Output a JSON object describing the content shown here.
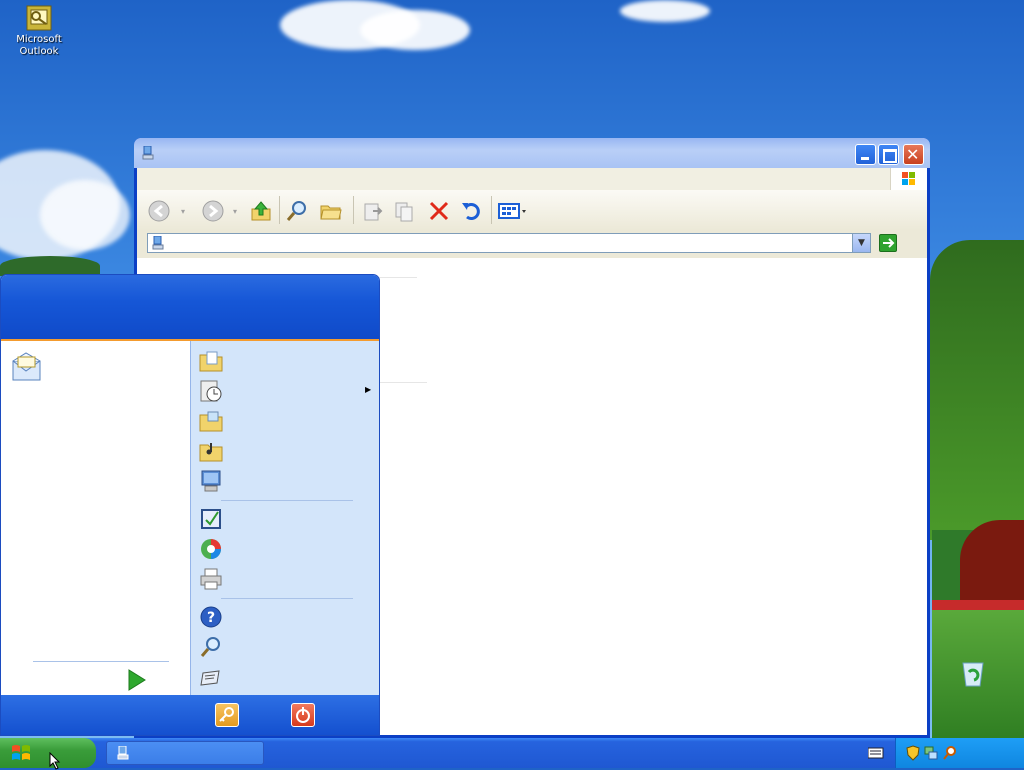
{
  "desktop": {
    "icons": [
      {
        "label_line1": "Microsoft",
        "label_line2": "Outlook",
        "icon": "outlook-icon"
      },
      {
        "label_line1": "",
        "label_line2": "",
        "icon": "recycle-bin-icon"
      }
    ]
  },
  "window": {
    "title": "",
    "address_value": "",
    "toolbar_icons": [
      "back-icon",
      "forward-icon",
      "up-folder-icon",
      "search-icon",
      "folders-icon",
      "move-to-icon",
      "copy-to-icon",
      "delete-icon",
      "undo-icon",
      "views-icon"
    ]
  },
  "start_menu": {
    "user_name": "",
    "pinned": [
      {
        "label": "",
        "icon": "email-icon"
      }
    ],
    "all_programs_label": "",
    "right_items": [
      {
        "label": "",
        "icon": "my-documents-icon"
      },
      {
        "label": "",
        "icon": "my-recent-documents-icon",
        "has_submenu": true
      },
      {
        "label": "",
        "icon": "my-pictures-icon"
      },
      {
        "label": "",
        "icon": "my-music-icon"
      },
      {
        "label": "",
        "icon": "my-computer-icon"
      },
      {
        "label": "",
        "icon": "control-panel-icon"
      },
      {
        "label": "",
        "icon": "set-program-access-icon"
      },
      {
        "label": "",
        "icon": "printers-icon"
      },
      {
        "label": "",
        "icon": "help-icon"
      },
      {
        "label": "",
        "icon": "search-icon"
      },
      {
        "label": "",
        "icon": "run-icon"
      }
    ],
    "footer": {
      "logoff_label": "",
      "shutdown_label": ""
    }
  },
  "taskbar": {
    "start_label": "",
    "task_label": "",
    "clock": ""
  },
  "colors": {
    "xp_blue": "#235ed9",
    "start_green": "#3a9d3a",
    "menu_orange": "#f49b2e",
    "tray_blue": "#0f86e0"
  }
}
